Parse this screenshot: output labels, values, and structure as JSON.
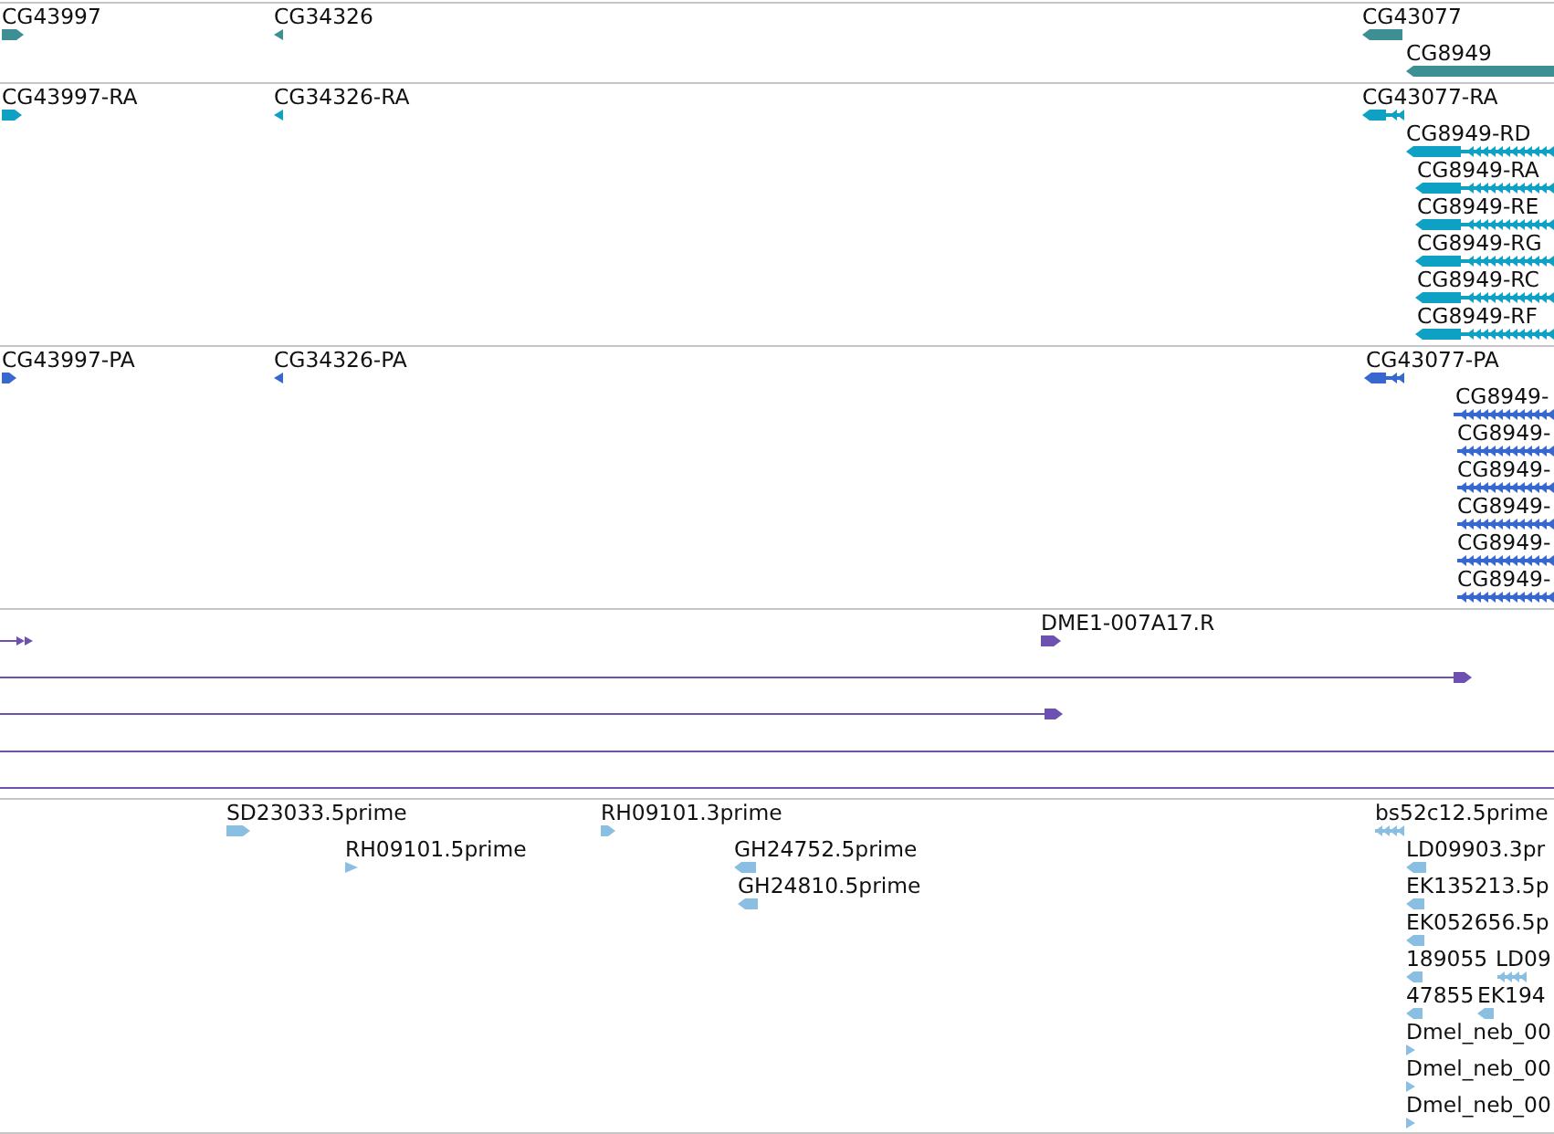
{
  "tracks": [
    {
      "kind": "gene",
      "features": [
        {
          "label": "CG43997",
          "reverse": false
        },
        {
          "label": "CG34326",
          "reverse": true
        },
        {
          "label": "CG43077",
          "reverse": true
        },
        {
          "label": "CG8949",
          "reverse": true
        }
      ]
    },
    {
      "kind": "transcript",
      "features": [
        {
          "label": "CG43997-RA",
          "reverse": false
        },
        {
          "label": "CG34326-RA",
          "reverse": true
        },
        {
          "label": "CG43077-RA",
          "reverse": true
        },
        {
          "label": "CG8949-RD",
          "reverse": true
        },
        {
          "label": "CG8949-RA",
          "reverse": true
        },
        {
          "label": "CG8949-RE",
          "reverse": true
        },
        {
          "label": "CG8949-RG",
          "reverse": true
        },
        {
          "label": "CG8949-RC",
          "reverse": true
        },
        {
          "label": "CG8949-RF",
          "reverse": true
        }
      ]
    },
    {
      "kind": "protein",
      "features": [
        {
          "label": "CG43997-PA",
          "reverse": false
        },
        {
          "label": "CG34326-PA",
          "reverse": true
        },
        {
          "label": "CG43077-PA",
          "reverse": true
        },
        {
          "label": "CG8949-",
          "reverse": true
        },
        {
          "label": "CG8949-",
          "reverse": true
        },
        {
          "label": "CG8949-",
          "reverse": true
        },
        {
          "label": "CG8949-",
          "reverse": true
        },
        {
          "label": "CG8949-",
          "reverse": true
        },
        {
          "label": "CG8949-",
          "reverse": true
        }
      ]
    },
    {
      "kind": "alignment",
      "features": [
        {
          "kind": "line",
          "reverse": false
        },
        {
          "kind": "block",
          "label": "DME1-007A17.R",
          "reverse": false
        },
        {
          "kind": "line",
          "reverse": false
        },
        {
          "kind": "line",
          "reverse": false
        },
        {
          "kind": "line"
        },
        {
          "kind": "line"
        }
      ]
    },
    {
      "kind": "est",
      "features": [
        {
          "label": "SD23033.5prime",
          "reverse": false
        },
        {
          "label": "RH09101.5prime",
          "reverse": false
        },
        {
          "label": "RH09101.3prime",
          "reverse": false
        },
        {
          "label": "GH24752.5prime",
          "reverse": true
        },
        {
          "label": "GH24810.5prime",
          "reverse": true
        },
        {
          "label": "bs52c12.5prime",
          "reverse": true
        },
        {
          "label": "LD09903.3pr",
          "reverse": true
        },
        {
          "label": "EK135213.5p",
          "reverse": true
        },
        {
          "label": "EK052656.5p",
          "reverse": true
        },
        {
          "label": "189055",
          "reverse": true
        },
        {
          "label": "LD09",
          "reverse": true
        },
        {
          "label": "47855",
          "reverse": true
        },
        {
          "label": "EK194",
          "reverse": true
        },
        {
          "label": "Dmel_neb_00",
          "reverse": false
        },
        {
          "label": "Dmel_neb_00",
          "reverse": false
        },
        {
          "label": "Dmel_neb_00",
          "reverse": false
        }
      ]
    }
  ]
}
